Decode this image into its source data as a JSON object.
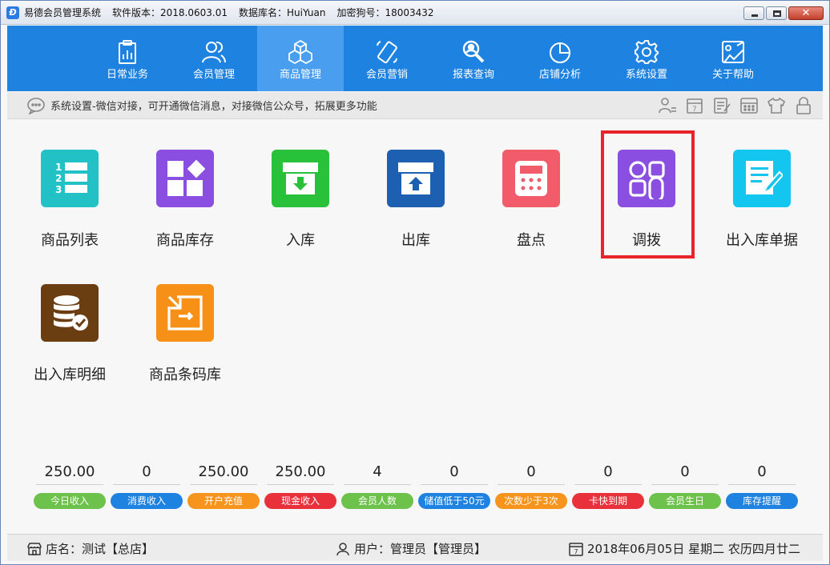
{
  "titlebar": {
    "app_name": "易德会员管理系统",
    "version": "软件版本：2018.0603.01",
    "database": "数据库名：HuiYuan",
    "dongle": "加密狗号：18003432"
  },
  "nav": [
    {
      "label": "日常业务",
      "icon": "clipboard-chart-icon"
    },
    {
      "label": "会员管理",
      "icon": "users-icon"
    },
    {
      "label": "商品管理",
      "icon": "cubes-icon",
      "active": true
    },
    {
      "label": "会员营销",
      "icon": "phone-icon"
    },
    {
      "label": "报表查询",
      "icon": "search-person-icon"
    },
    {
      "label": "店铺分析",
      "icon": "pie-chart-icon"
    },
    {
      "label": "系统设置",
      "icon": "gear-icon"
    },
    {
      "label": "关于帮助",
      "icon": "help-icon"
    }
  ],
  "info": {
    "message": "系统设置-微信对接，可开通微信消息，对接微信公众号，拓展更多功能"
  },
  "tiles": [
    {
      "label": "商品列表",
      "color": "#22c1c6",
      "icon": "list-icon"
    },
    {
      "label": "商品库存",
      "color": "#8a4fe0",
      "icon": "inventory-icon"
    },
    {
      "label": "入库",
      "color": "#29c03a",
      "icon": "stock-in-icon"
    },
    {
      "label": "出库",
      "color": "#1d5fb0",
      "icon": "stock-out-icon"
    },
    {
      "label": "盘点",
      "color": "#f25c6a",
      "icon": "calculator-icon"
    },
    {
      "label": "调拨",
      "color": "#8a4fe0",
      "icon": "transfer-icon"
    },
    {
      "label": "出入库单据",
      "color": "#13c6f0",
      "icon": "document-edit-icon"
    },
    {
      "label": "出入库明细",
      "color": "#6b3e12",
      "icon": "database-check-icon"
    },
    {
      "label": "商品条码库",
      "color": "#f79016",
      "icon": "barcode-library-icon"
    }
  ],
  "stats": [
    {
      "value": "250.00",
      "label": "今日收入",
      "color": "#6cc24a"
    },
    {
      "value": "0",
      "label": "消费收入",
      "color": "#1e82e0"
    },
    {
      "value": "250.00",
      "label": "开户充值",
      "color": "#f7941d"
    },
    {
      "value": "250.00",
      "label": "现金收入",
      "color": "#e8313a"
    },
    {
      "value": "4",
      "label": "会员人数",
      "color": "#6cc24a"
    },
    {
      "value": "0",
      "label": "储值低于50元",
      "color": "#1e82e0"
    },
    {
      "value": "0",
      "label": "次数少于3次",
      "color": "#f7941d"
    },
    {
      "value": "0",
      "label": "卡快到期",
      "color": "#e8313a"
    },
    {
      "value": "0",
      "label": "会员生日",
      "color": "#6cc24a"
    },
    {
      "value": "0",
      "label": "库存提醒",
      "color": "#1e82e0"
    }
  ],
  "status": {
    "shop": "店名：测试【总店】",
    "user": "用户：管理员【管理员】",
    "date": "2018年06月05日 星期二 农历四月廿二"
  },
  "colors": {
    "nav_bg": "#1e82e0",
    "nav_active": "#4a9ef0",
    "highlight": "#e8232a"
  }
}
